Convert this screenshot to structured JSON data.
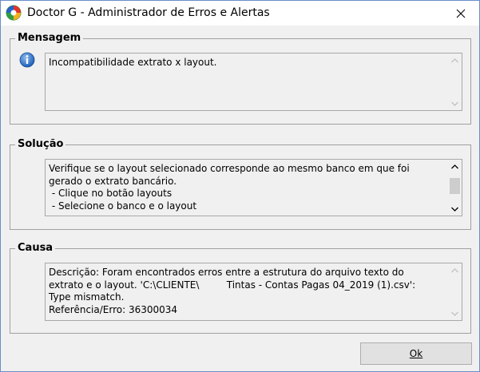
{
  "window": {
    "title": "Doctor G - Administrador de Erros e Alertas",
    "close_glyph": "✕"
  },
  "mensagem": {
    "title": "Mensagem",
    "icon": "info-icon",
    "text": "Incompatibilidade extrato x layout."
  },
  "solucao": {
    "title": "Solução",
    "text": "Verifique se o layout selecionado corresponde ao mesmo banco em que foi\ngerado o extrato bancário.\n - Clique no botão layouts\n - Selecione o banco e o layout",
    "scroll_position": 0.0
  },
  "causa": {
    "title": "Causa",
    "text": "Descrição: Foram encontrados erros entre a estrutura do arquivo texto do\nextrato e o layout. 'C:\\CLIENTE\\         Tintas - Contas Pagas 04_2019 (1).csv':\nType mismatch.\nReferência/Erro: 36300034"
  },
  "buttons": {
    "ok_label": "Ok"
  },
  "colors": {
    "info_blue": "#1c5fb8",
    "window_border": "#6a8ec9",
    "face": "#f0f0f0"
  }
}
